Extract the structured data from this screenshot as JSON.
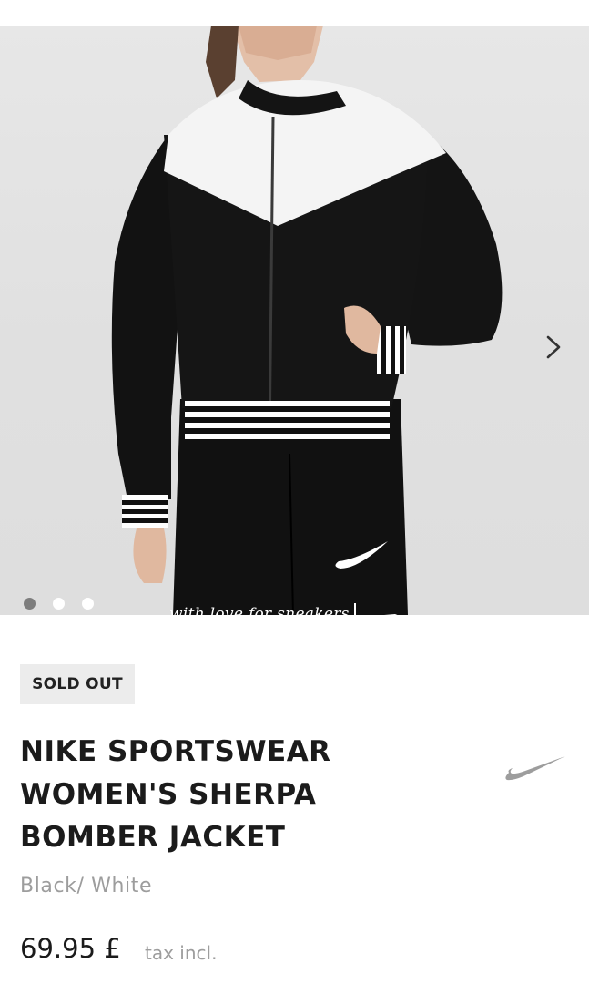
{
  "gallery": {
    "image_alt": "Model wearing black and white sherpa bomber jacket",
    "watermark": "with love for sneakers",
    "watermark_logo": "FOOTSHOP",
    "active_slide": 1,
    "slide_count": 3,
    "next_icon": "chevron-right-icon"
  },
  "product": {
    "badge": "SOLD OUT",
    "title_lines": [
      "NIKE SPORTSWEAR",
      "WOMEN'S SHERPA",
      "BOMBER JACKET"
    ],
    "color": "Black/ White",
    "price": "69.95 £",
    "tax_note": "tax incl.",
    "brand_icon": "nike-swoosh-icon"
  },
  "colors": {
    "badge_bg": "#ececec",
    "text_primary": "#1b1b1b",
    "text_muted": "#9d9d9d",
    "dot_active": "#7d7d7d"
  }
}
